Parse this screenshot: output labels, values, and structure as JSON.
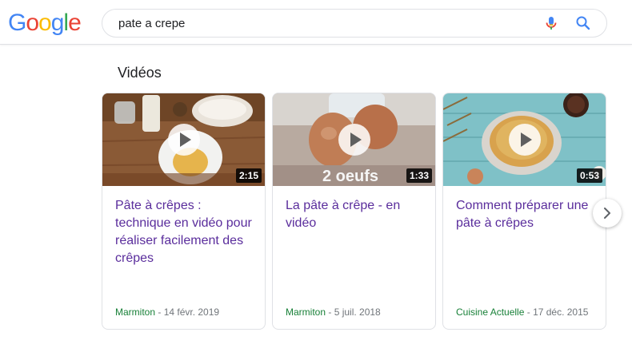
{
  "logo": {
    "letters": [
      "G",
      "o",
      "o",
      "g",
      "l",
      "e"
    ],
    "colors": [
      "#4285F4",
      "#EA4335",
      "#FBBC05",
      "#4285F4",
      "#34A853",
      "#EA4335"
    ]
  },
  "search": {
    "query": "pate a crepe",
    "mic_icon": "microphone-icon",
    "search_icon": "search-icon"
  },
  "section": {
    "title": "Vidéos"
  },
  "videos": [
    {
      "title": "Pâte à crêpes : technique en vidéo pour réaliser facilement des crêpes",
      "source": "Marmiton",
      "date": "14 févr. 2019",
      "duration": "2:15"
    },
    {
      "title": "La pâte à crêpe - en vidéo",
      "source": "Marmiton",
      "date": "5 juil. 2018",
      "duration": "1:33",
      "overlay_text": "2 oeufs"
    },
    {
      "title": "Comment préparer une pâte à crêpes",
      "source": "Cuisine Actuelle",
      "date": "17 déc. 2015",
      "duration": "0:53"
    }
  ],
  "next_icon": "chevron-right-icon",
  "colors": {
    "link_visited": "#5a2d9c",
    "source_green": "#188038",
    "meta_gray": "#70757a"
  }
}
